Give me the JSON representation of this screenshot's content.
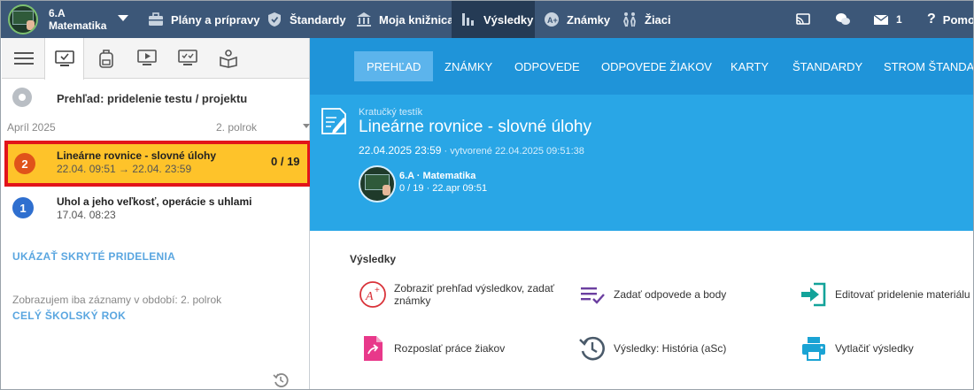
{
  "topnav": {
    "class_line1": "6.A",
    "class_line2": "Matematika",
    "items": [
      {
        "label": "Plány a prípravy",
        "icon": "briefcase-icon"
      },
      {
        "label": "Štandardy",
        "icon": "shield-icon"
      },
      {
        "label": "Moja knižnica",
        "icon": "library-icon"
      },
      {
        "label": "Výsledky",
        "icon": "bar-chart-icon",
        "active": true
      },
      {
        "label": "Známky",
        "icon": "grade-icon"
      },
      {
        "label": "Žiaci",
        "icon": "students-icon"
      }
    ],
    "messages_count": "1",
    "help_label": "Pomoc"
  },
  "left": {
    "overview_label": "Prehľad: pridelenie testu / projektu",
    "period_month": "Apríl 2025",
    "period_semester": "2. polrok",
    "assignments": [
      {
        "num": "2",
        "title": "Lineárne rovnice - slovné úlohy",
        "sub": "22.04. 09:51 → 22.04. 23:59",
        "score": "0 / 19",
        "color": "#e0531a"
      },
      {
        "num": "1",
        "title": "Uhol a jeho veľkosť, operácie s uhlami",
        "sub": "17.04. 08:23",
        "score": "",
        "color": "#2f6fcf"
      }
    ],
    "show_hidden": "UKÁZAŤ SKRYTÉ PRIDELENIA",
    "period_note": "Zobrazujem iba záznamy v období: 2. polrok",
    "whole_year": "CELÝ ŠKOLSKÝ ROK"
  },
  "tabs": [
    "PREHĽAD",
    "ZNÁMKY",
    "ODPOVEDE",
    "ODPOVEDE ŽIAKOV",
    "KARTY",
    "ŠTANDARDY",
    "STROM ŠTANDARDOV"
  ],
  "banner": {
    "type": "Kratučký testík",
    "title": "Lineárne rovnice - slovné úlohy",
    "date": "22.04.2025 23:59",
    "created": " · vytvorené 22.04.2025 09:51:38",
    "class_name": "6.A · Matematika",
    "class_stats": "0 / 19 · 22.apr 09:51"
  },
  "results": {
    "title": "Výsledky",
    "actions": [
      {
        "label": "Zobraziť prehľad výsledkov, zadať známky",
        "icon": "grade-a-plus-icon"
      },
      {
        "label": "Zadať odpovede a body",
        "icon": "list-check-icon"
      },
      {
        "label": "Editovať pridelenie materiálu",
        "icon": "edit-assignment-icon"
      },
      {
        "label": "Rozposlať práce žiakov",
        "icon": "send-document-icon"
      },
      {
        "label": "Výsledky: História (aSc)",
        "icon": "history-icon"
      },
      {
        "label": "Vytlačiť výsledky",
        "icon": "printer-icon"
      }
    ]
  },
  "colors": {
    "topnav": "#3c5778",
    "tabs_bar": "#1f94d9",
    "banner": "#29a6e6",
    "selected": "#fec32a",
    "highlight_border": "#e2141a",
    "link": "#5aa6e0"
  }
}
